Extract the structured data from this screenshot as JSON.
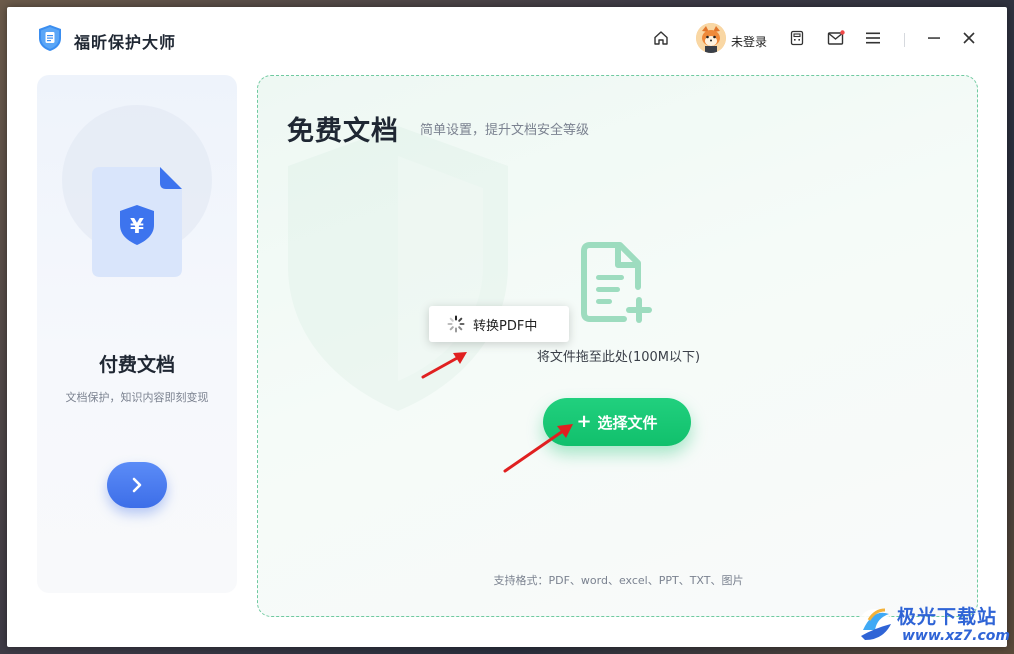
{
  "app": {
    "title": "福昕保护大师"
  },
  "titlebar": {
    "login_label": "未登录",
    "icons": [
      "home-icon",
      "avatar",
      "calculator-icon",
      "mail-icon",
      "menu-icon",
      "minimize-icon",
      "close-icon"
    ]
  },
  "left_card": {
    "title": "付费文档",
    "subtitle": "文档保护，知识内容即刻变现",
    "icon": "yen-shield-doc-icon"
  },
  "main": {
    "title": "免费文档",
    "subtitle": "简单设置，提升文档安全等级",
    "drop_hint": "将文件拖至此处(100M以下)",
    "select_button": "选择文件",
    "formats": "支持格式：PDF、word、excel、PPT、TXT、图片"
  },
  "toast": {
    "text": "转换PDF中"
  },
  "watermark": {
    "name": "极光下载站",
    "url": "www.xz7.com"
  },
  "colors": {
    "accent_green": "#11c06c",
    "accent_blue": "#3d6ee8",
    "annotation_red": "#e02020",
    "watermark_blue": "#2f64d6"
  }
}
